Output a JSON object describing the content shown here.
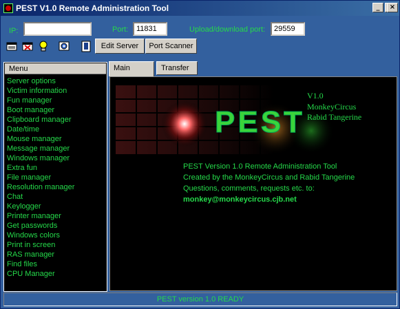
{
  "window": {
    "title": "PEST V1.0 Remote Administration Tool"
  },
  "connection": {
    "ip_label": "IP:",
    "ip_value": "",
    "port_label": "Port:",
    "port_value": "11831",
    "upload_label": "Upload/download port:",
    "upload_value": "29559"
  },
  "toolbar": {
    "icons": [
      "disconnect-icon",
      "delete-icon",
      "lightbulb-icon",
      "settings-icon",
      "book-icon"
    ],
    "edit_server_label": "Edit Server",
    "port_scanner_label": "Port Scanner"
  },
  "menu": {
    "header": "Menu",
    "items": [
      "Server options",
      "Victim information",
      "Fun manager",
      "Boot manager",
      "Clipboard manager",
      "Date/time",
      "Mouse manager",
      "Message manager",
      "Windows manager",
      "Extra fun",
      "File manager",
      "Resolution manager",
      "Chat",
      "Keylogger",
      "Printer manager",
      "Get passwords",
      "Windows colors",
      "Print in screen",
      "RAS manager",
      "Find files",
      "CPU Manager"
    ]
  },
  "tabs": [
    {
      "label": "Main"
    },
    {
      "label": "Transfer"
    }
  ],
  "main": {
    "logo_text": "PEST",
    "credits": [
      "V1.0",
      "MonkeyCircus",
      "Rabid Tangerine"
    ],
    "info_lines": [
      "PEST Version 1.0 Remote Administration Tool",
      "Created by the MonkeyCircus and Rabid Tangerine",
      "Questions, comments, requests etc. to:"
    ],
    "email": "monkey@monkeycircus.cjb.net"
  },
  "status": {
    "text": "PEST version 1.0 READY"
  },
  "colors": {
    "green_text": "#25d94a",
    "panel_blue": "#33609e",
    "title_blue": "#0a246a"
  }
}
